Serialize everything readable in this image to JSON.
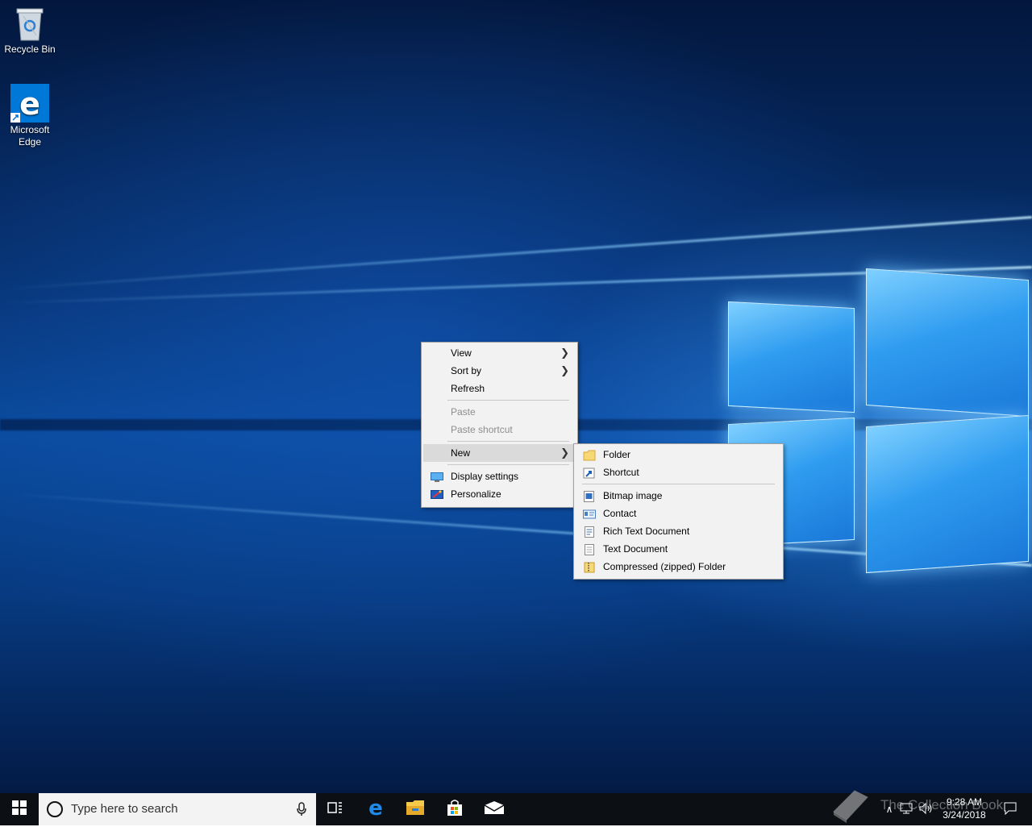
{
  "desktop": {
    "icons": [
      {
        "label": "Recycle Bin",
        "icon": "recycle-bin-icon"
      },
      {
        "label": "Microsoft Edge",
        "icon": "edge-icon"
      }
    ]
  },
  "context_menu": {
    "items": [
      {
        "label": "View",
        "has_submenu": true,
        "enabled": true
      },
      {
        "label": "Sort by",
        "has_submenu": true,
        "enabled": true
      },
      {
        "label": "Refresh",
        "has_submenu": false,
        "enabled": true
      },
      {
        "label": "Paste",
        "has_submenu": false,
        "enabled": false
      },
      {
        "label": "Paste shortcut",
        "has_submenu": false,
        "enabled": false
      },
      {
        "label": "New",
        "has_submenu": true,
        "enabled": true,
        "highlighted": true
      },
      {
        "label": "Display settings",
        "icon": "display-icon",
        "enabled": true
      },
      {
        "label": "Personalize",
        "icon": "personalize-icon",
        "enabled": true
      }
    ]
  },
  "new_submenu": {
    "items": [
      {
        "label": "Folder",
        "icon": "folder-icon"
      },
      {
        "label": "Shortcut",
        "icon": "shortcut-icon"
      },
      {
        "label": "Bitmap image",
        "icon": "bitmap-icon"
      },
      {
        "label": "Contact",
        "icon": "contact-icon"
      },
      {
        "label": "Rich Text Document",
        "icon": "rich-text-icon"
      },
      {
        "label": "Text Document",
        "icon": "text-document-icon"
      },
      {
        "label": "Compressed (zipped) Folder",
        "icon": "zip-folder-icon"
      }
    ]
  },
  "taskbar": {
    "search_placeholder": "Type here to search",
    "pinned": [
      "task-view-icon",
      "edge-icon",
      "file-explorer-icon",
      "store-icon",
      "mail-icon"
    ],
    "clock_time": "9:28 AM",
    "clock_date": "3/24/2018"
  },
  "watermark": {
    "text": "The Collection Book"
  },
  "colors": {
    "taskbar": "#0c0f14",
    "menu_bg": "#f2f2f2",
    "menu_highlight": "#dadada",
    "edge_blue": "#0078d7"
  }
}
